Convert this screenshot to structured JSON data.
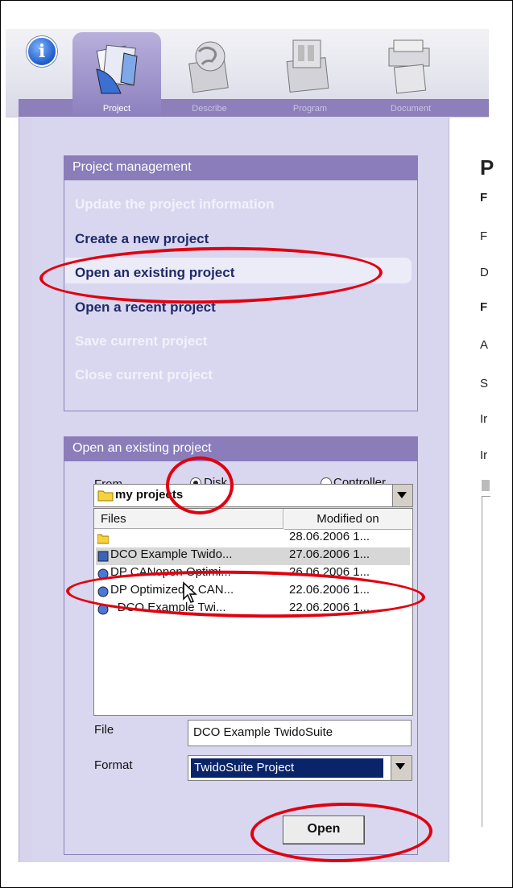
{
  "window": {
    "tabs": [
      {
        "label": "Project",
        "active": true,
        "icon": "project-folders-icon"
      },
      {
        "label": "Describe",
        "active": false,
        "icon": "describe-globe-icon"
      },
      {
        "label": "Program",
        "active": false,
        "icon": "program-controller-icon"
      },
      {
        "label": "Document",
        "active": false,
        "icon": "document-printer-icon"
      }
    ],
    "info_icon": "i"
  },
  "project_management": {
    "title": "Project management",
    "items": [
      {
        "label": "Update the project information",
        "enabled": false
      },
      {
        "label": "Create a new project",
        "enabled": true
      },
      {
        "label": "Open an existing project",
        "enabled": true,
        "highlighted": true
      },
      {
        "label": "Open a recent project",
        "enabled": true
      },
      {
        "label": "Save current project",
        "enabled": false
      },
      {
        "label": "Close current project",
        "enabled": false
      }
    ]
  },
  "open_existing": {
    "title": "Open an existing project",
    "from_label": "From",
    "disk_label": "Disk",
    "controller_label": "Controller",
    "selected_source": "Disk",
    "folder": "my projects",
    "columns": {
      "files": "Files",
      "modified": "Modified on"
    },
    "files": [
      {
        "name": "",
        "modified": "28.06.2006 1...",
        "type": "folder"
      },
      {
        "name": "DCO Example Twido...",
        "modified": "27.06.2006 1...",
        "type": "project",
        "selected": true
      },
      {
        "name": "DP CANopen Optimi...",
        "modified": "26.06.2006 1...",
        "type": "project"
      },
      {
        "name": "DP Optimized 2 CAN...",
        "modified": "22.06.2006 1...",
        "type": "project"
      },
      {
        "name": "~DCO Example Twi...",
        "modified": "22.06.2006 1...",
        "type": "project"
      }
    ],
    "file_label": "File",
    "file_value": "DCO Example TwidoSuite",
    "format_label": "Format",
    "format_value": "TwidoSuite Project",
    "open_button": "Open"
  },
  "right_panel": {
    "heading": "P",
    "letters": [
      "F",
      "F",
      "D",
      "F",
      "A",
      "S",
      "Ir",
      "Ir"
    ]
  },
  "colors": {
    "header": "#8a7dba",
    "menu_text": "#1f2a6b",
    "annotation": "#e00010",
    "selection": "#0a246a"
  }
}
